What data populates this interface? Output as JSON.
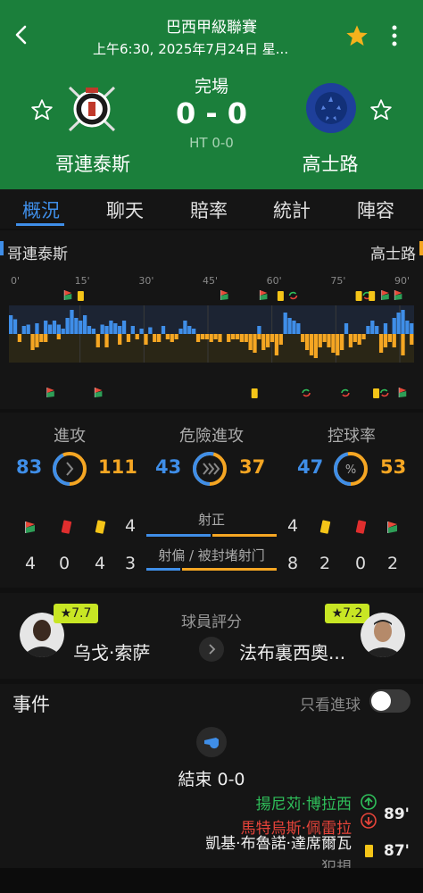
{
  "header": {
    "league": "巴西甲級聯賽",
    "datetime": "上午6:30, 2025年7月24日 星...",
    "status": "完場",
    "score": "0 - 0",
    "halftime": "HT 0-0",
    "home": {
      "name": "哥連泰斯"
    },
    "away": {
      "name": "高士路"
    },
    "colors": {
      "bg": "#1b7f3b",
      "fav": "#f5b21c"
    }
  },
  "tabs": [
    {
      "label": "概況",
      "active": true
    },
    {
      "label": "聊天"
    },
    {
      "label": "賠率"
    },
    {
      "label": "統計"
    },
    {
      "label": "陣容"
    }
  ],
  "momentum": {
    "home_label": "哥連泰斯",
    "away_label": "高士路",
    "minute_ticks": [
      "0'",
      "15'",
      "30'",
      "45'",
      "60'",
      "75'",
      "90'"
    ],
    "home_color": "#3f8ee8",
    "away_color": "#f5a623",
    "home_values": [
      0.7,
      0.55,
      0,
      0.3,
      0.35,
      0,
      0.4,
      0,
      0.5,
      0.35,
      0.5,
      0.35,
      0.2,
      0.6,
      0.9,
      0.6,
      0.5,
      0.7,
      0.3,
      0.2,
      0,
      0.35,
      0.3,
      0.5,
      0.4,
      0.3,
      0.5,
      0,
      0.3,
      0,
      0.2,
      0,
      0.25,
      0,
      0,
      0.3,
      0,
      0,
      0,
      0.2,
      0.5,
      0.3,
      0.2,
      0,
      0,
      0,
      0,
      0,
      0,
      0,
      0,
      0,
      0,
      0,
      0,
      0,
      0,
      0.3,
      0,
      0,
      0,
      0,
      0,
      0.8,
      0.6,
      0.5,
      0.4,
      0,
      0,
      0,
      0,
      0,
      0,
      0,
      0,
      0,
      0,
      0.4,
      0,
      0,
      0,
      0,
      0.3,
      0.5,
      0.3,
      0,
      0.4,
      0,
      0.6,
      0.8,
      0.9,
      0.5,
      0.4
    ],
    "away_values": [
      0,
      0,
      0.3,
      0,
      0,
      0.6,
      0.5,
      0.3,
      0.3,
      0,
      0,
      0.2,
      0,
      0,
      0,
      0,
      0,
      0,
      0,
      0,
      0.5,
      0,
      0.5,
      0,
      0,
      0.4,
      0,
      0.3,
      0,
      0.2,
      0,
      0.4,
      0,
      0.3,
      0.3,
      0,
      0.2,
      0.3,
      0.2,
      0,
      0,
      0,
      0,
      0.3,
      0.2,
      0.2,
      0.3,
      0.2,
      0.3,
      0,
      0.3,
      0.2,
      0.2,
      0.3,
      0.3,
      0.6,
      0.7,
      0.2,
      0.6,
      0.5,
      0.3,
      0.8,
      0.4,
      0,
      0,
      0,
      0,
      0.3,
      0.6,
      0.8,
      0.9,
      0.5,
      0.3,
      0.5,
      0.7,
      0.8,
      0.6,
      0,
      0.5,
      0.3,
      0.4,
      0.2,
      0,
      0,
      0,
      0.7,
      0.5,
      0.3,
      0.5,
      0,
      0.8,
      0,
      0.4,
      0.5,
      0.3,
      0
    ],
    "home_events": [
      {
        "minute": 13,
        "type": "corner"
      },
      {
        "minute": 16,
        "type": "yellow"
      },
      {
        "minute": 49,
        "type": "corner"
      },
      {
        "minute": 58,
        "type": "corner"
      },
      {
        "minute": 62,
        "type": "yellow"
      },
      {
        "minute": 65,
        "type": "sub"
      },
      {
        "minute": 80,
        "type": "yellow"
      },
      {
        "minute": 82,
        "type": "sub"
      },
      {
        "minute": 83,
        "type": "yellow"
      },
      {
        "minute": 86,
        "type": "corner"
      },
      {
        "minute": 89,
        "type": "corner"
      }
    ],
    "away_events": [
      {
        "minute": 9,
        "type": "corner"
      },
      {
        "minute": 20,
        "type": "corner"
      },
      {
        "minute": 56,
        "type": "yellow"
      },
      {
        "minute": 68,
        "type": "sub"
      },
      {
        "minute": 77,
        "type": "sub"
      },
      {
        "minute": 84,
        "type": "yellow"
      },
      {
        "minute": 86,
        "type": "sub"
      },
      {
        "minute": 90,
        "type": "corner"
      }
    ]
  },
  "stats": {
    "attacks": {
      "label": "進攻",
      "home": "83",
      "away": "111",
      "home_share": 0.43
    },
    "dangerous": {
      "label": "危險進攻",
      "home": "43",
      "away": "37",
      "home_share": 0.54
    },
    "possession": {
      "label": "控球率",
      "home": "47",
      "away": "53",
      "home_share": 0.47
    },
    "shots_on_label": "射正",
    "shots_off_label": "射偏 / 被封堵射门",
    "home": {
      "corner_top": "4",
      "shots_on": "4",
      "corners": "4",
      "reds": "0",
      "yellows": "4",
      "shots_off": "3"
    },
    "away": {
      "shots_on": "4",
      "corner_top": "4",
      "shots_off": "8",
      "yellows": "2",
      "reds": "0",
      "corners": "2"
    },
    "shots_on_home_share": 0.5,
    "shots_off_home_share": 0.27
  },
  "ratings": {
    "title": "球員評分",
    "home_player": {
      "name": "乌戈·索萨",
      "rating": "★7.7"
    },
    "away_player": {
      "name": "法布裏西奧...",
      "rating": "★7.2"
    }
  },
  "events": {
    "title": "事件",
    "filter_label": "只看進球",
    "end_label": "結束 0-0",
    "items": [
      {
        "in": "揚尼苅·博拉西",
        "out": "馬特烏斯·佩雷拉",
        "minute": "89'",
        "type": "sub"
      },
      {
        "player": "凱基·布魯諾·達席爾瓦",
        "minute": "87'",
        "type": "yellow"
      },
      {
        "note": "犯規"
      }
    ]
  }
}
